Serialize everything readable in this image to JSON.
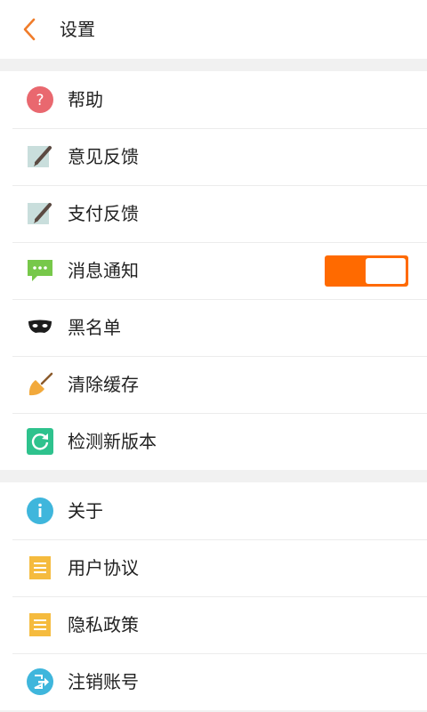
{
  "header": {
    "title": "设置",
    "back_icon": "chevron-left-icon",
    "accent_color": "#ff6a00"
  },
  "groups": [
    {
      "items": [
        {
          "label": "帮助",
          "icon": "help-icon"
        },
        {
          "label": "意见反馈",
          "icon": "feedback-pen-icon"
        },
        {
          "label": "支付反馈",
          "icon": "payment-feedback-pen-icon"
        },
        {
          "label": "消息通知",
          "icon": "message-icon",
          "toggle": {
            "on": true
          }
        },
        {
          "label": "黑名单",
          "icon": "mask-icon"
        },
        {
          "label": "清除缓存",
          "icon": "broom-icon"
        },
        {
          "label": "检测新版本",
          "icon": "refresh-icon"
        }
      ]
    },
    {
      "items": [
        {
          "label": "关于",
          "icon": "info-icon"
        },
        {
          "label": "用户协议",
          "icon": "document-icon"
        },
        {
          "label": "隐私政策",
          "icon": "document-icon"
        },
        {
          "label": "注销账号",
          "icon": "logout-icon"
        }
      ]
    }
  ]
}
